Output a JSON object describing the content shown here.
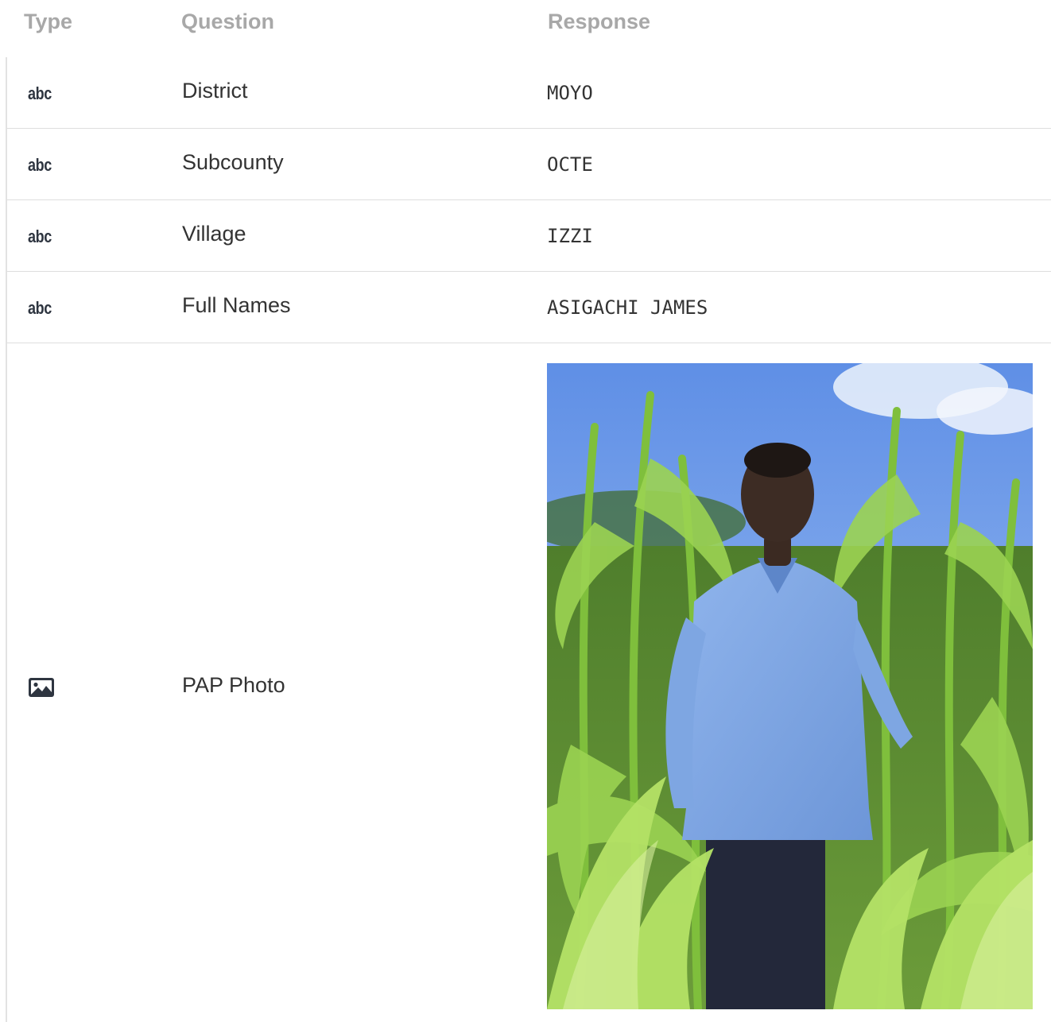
{
  "header": {
    "type_label": "Type",
    "question_label": "Question",
    "response_label": "Response"
  },
  "rows": [
    {
      "type_icon": "abc",
      "question": "District",
      "response": "MOYO"
    },
    {
      "type_icon": "abc",
      "question": "Subcounty",
      "response": "OCTE"
    },
    {
      "type_icon": "abc",
      "question": "Village",
      "response": "IZZI"
    },
    {
      "type_icon": "abc",
      "question": "Full Names",
      "response": "ASIGACHI JAMES"
    }
  ],
  "photo_row": {
    "type_icon": "image-icon",
    "question": "PAP Photo"
  }
}
